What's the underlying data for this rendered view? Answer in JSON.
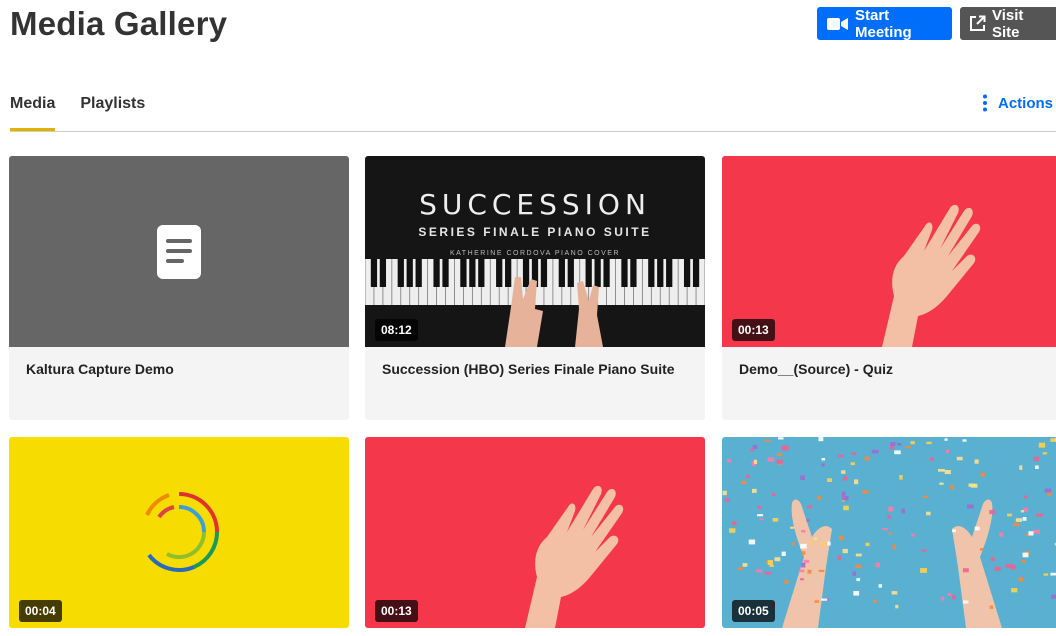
{
  "page": {
    "title": "Media Gallery"
  },
  "header_buttons": {
    "start_meeting": "Start Meeting",
    "visit_site": "Visit Site"
  },
  "tabs": [
    {
      "label": "Media",
      "active": true
    },
    {
      "label": "Playlists",
      "active": false
    }
  ],
  "actions": {
    "label": "Actions"
  },
  "media": [
    {
      "title": "Kaltura Capture Demo",
      "duration": null,
      "thumb": "document-icon"
    },
    {
      "title": "Succession (HBO) Series Finale Piano Suite",
      "duration": "08:12",
      "thumb": "piano"
    },
    {
      "title": "Demo__(Source) - Quiz",
      "duration": "00:13",
      "thumb": "hand"
    },
    {
      "title": "",
      "duration": "00:04",
      "thumb": "spinner"
    },
    {
      "title": "",
      "duration": "00:13",
      "thumb": "hand"
    },
    {
      "title": "",
      "duration": "00:05",
      "thumb": "confetti"
    }
  ],
  "piano_thumb": {
    "title": "SUCCESSION",
    "subtitle": "SERIES FINALE PIANO SUITE",
    "credit": "KATHERINE CORDOVA PIANO COVER"
  },
  "colors": {
    "accent_blue": "#006efa",
    "visit_gray": "#555555",
    "tab_underline": "#e0b200",
    "thumb_red": "#f5374c",
    "thumb_yellow": "#f7dc00",
    "thumb_gray": "#666666",
    "thumb_blue": "#5ab0d0"
  }
}
